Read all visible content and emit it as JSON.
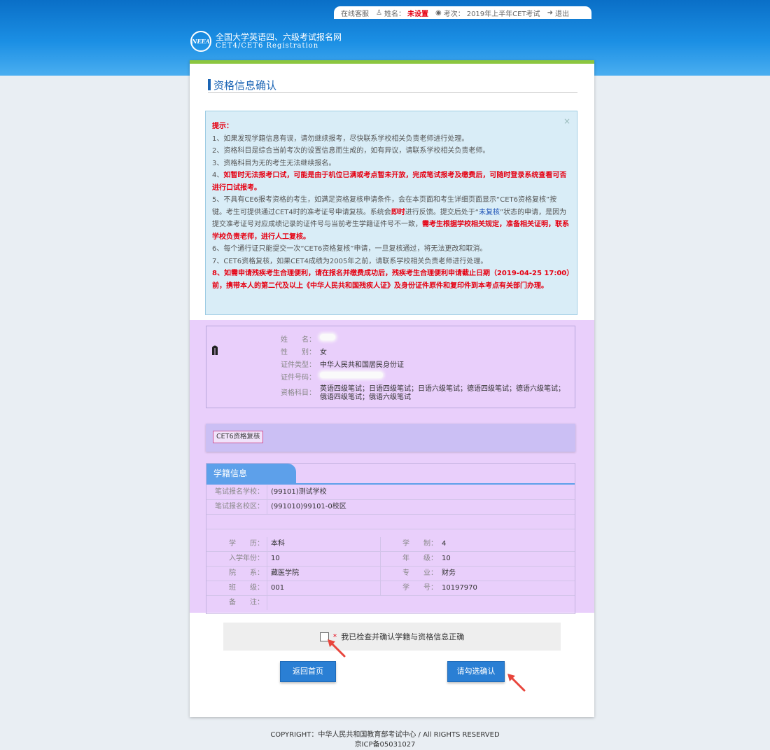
{
  "topbar": {
    "service": "在线客服",
    "name_label": "姓名：",
    "name_value": "未设置",
    "exam_label": "考次：",
    "exam_value": "2019年上半年CET考试",
    "logout": "退出"
  },
  "logo": {
    "title": "全国大学英语四、六级考试报名网",
    "subtitle": "CET4/CET6 Registration"
  },
  "page_title": "资格信息确认",
  "notice": {
    "heading": "提示：",
    "close": "×",
    "items": [
      "1、如果发现学籍信息有误，请勿继续报考，尽快联系学校相关负责老师进行处理。",
      "2、资格科目是综合当前考次的设置信息而生成的，如有异议，请联系学校相关负责老师。",
      "3、资格科目为无的考生无法继续报名。"
    ],
    "item4_prefix": "4、",
    "item4_red": "如暂时无法报考口试，可能是由于机位已满或考点暂未开放，完成笔试报考及缴费后，可随时登录系统查看可否进行口试报考。",
    "item5_a": "5、不具有CE6报考资格的考生，如满足资格复核申请条件，会在本页面和考生详细页面显示“CET6资格复核”按键。考生可提供通过CET4时的准考证号申请复核。系统会",
    "item5_red1": "即时",
    "item5_b": "进行反馈。提交后处于“",
    "item5_blue": "未复核",
    "item5_c": "”状态的申请，是因为提交准考证号对应成绩记录的证件号与当前考生学籍证件号不一致，",
    "item5_red2": "需考生根据学校相关规定，准备相关证明，联系学校负责老师，进行人工复核。",
    "item6": "6、每个通行证只能提交一次“CET6资格复核”申请，一旦复核通过，将无法更改和取消。",
    "item7": "7、CET6资格复核，如果CET4成绩为2005年之前，请联系学校相关负责老师进行处理。",
    "item8": "8、如需申请残疾考生合理便利，请在报名并缴费成功后，残疾考生合理便利申请截止日期（2019-04-25 17:00）前，携带本人的第二代及以上《中华人民共和国残疾人证》及身份证件原件和复印件到本考点有关部门办理。"
  },
  "person": {
    "name_label": "姓　　名：",
    "gender_label": "性　　别：",
    "gender_value": "女",
    "idtype_label": "证件类型：",
    "idtype_value": "中华人民共和国居民身份证",
    "idno_label": "证件号码：",
    "subjects_label": "资格科目：",
    "subjects_line1": "英语四级笔试；日语四级笔试；日语六级笔试；德语四级笔试；德语六级笔试；",
    "subjects_line2": "俄语四级笔试；俄语六级笔试"
  },
  "review_button": "CET6资格复核",
  "edu": {
    "tab": "学籍信息",
    "school_label": "笔试报名学校：",
    "school_value": "(99101)测试学校",
    "campus_label": "笔试报名校区：",
    "campus_value": "(991010)99101-0校区",
    "rows": [
      {
        "l1": "学　　历：",
        "v1": "本科",
        "l2": "学　　制：",
        "v2": "4"
      },
      {
        "l1": "入学年份：",
        "v1": "10",
        "l2": "年　　级：",
        "v2": "10"
      },
      {
        "l1": "院　　系：",
        "v1": "藏医学院",
        "l2": "专　　业：",
        "v2": "财务"
      },
      {
        "l1": "班　　级：",
        "v1": "001",
        "l2": "学　　号：",
        "v2": "10197970"
      }
    ],
    "remark_label": "备　　注："
  },
  "confirm": {
    "star": "*",
    "text": "我已检查并确认学籍与资格信息正确"
  },
  "buttons": {
    "home": "返回首页",
    "confirm": "请勾选确认"
  },
  "footer": {
    "copyright": "COPYRIGHT：中华人民共和国教育部考试中心 / All RIGHTS RESERVED",
    "icp": "京ICP备05031027"
  },
  "colors": {
    "header_blue": "#1b8fe4",
    "accent_green": "#8cc63f",
    "purple_highlight": "#e9cffb",
    "button_blue": "#2a7fd4",
    "warning_red": "#e60012",
    "arrow_red": "#e8453c"
  }
}
